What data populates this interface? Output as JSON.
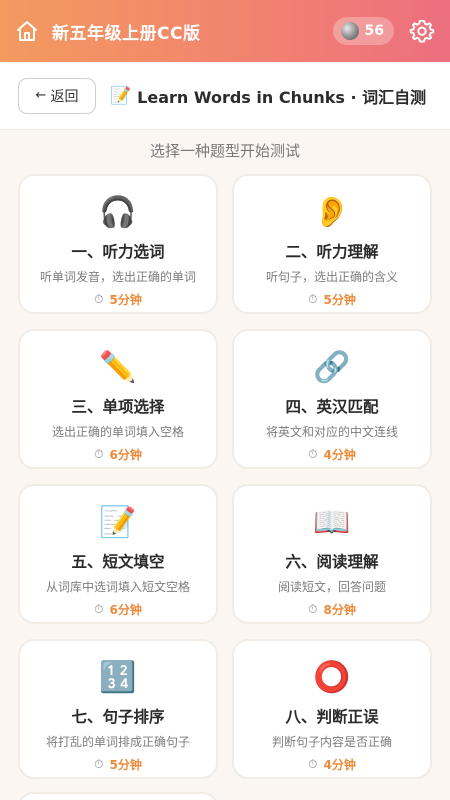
{
  "header": {
    "title": "新五年级上册CC版",
    "coins": "56",
    "coin_icon": "moon-icon",
    "home_icon": "home-icon",
    "settings_icon": "gear-icon",
    "gradient": [
      "#f39a5f",
      "#ec6f7f"
    ]
  },
  "toolbar": {
    "back_label": "返回",
    "back_arrow": "←",
    "memo_glyph": "📝",
    "title": "Learn Words in Chunks · 词汇自测"
  },
  "subtitle": "选择一种题型开始测试",
  "timer_glyph": "⏱",
  "accent_color": "#ee8a3a",
  "cards": [
    {
      "glyph": "🎧",
      "icon": "headphones-icon",
      "title": "一、听力选词",
      "desc": "听单词发音，选出正确的单词",
      "time": "5分钟"
    },
    {
      "glyph": "👂",
      "icon": "ear-icon",
      "title": "二、听力理解",
      "desc": "听句子，选出正确的含义",
      "time": "5分钟"
    },
    {
      "glyph": "✏️",
      "icon": "pencil-icon",
      "title": "三、单项选择",
      "desc": "选出正确的单词填入空格",
      "time": "6分钟"
    },
    {
      "glyph": "🔗",
      "icon": "link-icon",
      "title": "四、英汉匹配",
      "desc": "将英文和对应的中文连线",
      "time": "4分钟"
    },
    {
      "glyph": "📝",
      "icon": "memo-icon",
      "title": "五、短文填空",
      "desc": "从词库中选词填入短文空格",
      "time": "6分钟"
    },
    {
      "glyph": "📖",
      "icon": "book-icon",
      "title": "六、阅读理解",
      "desc": "阅读短文，回答问题",
      "time": "8分钟"
    },
    {
      "glyph": "🔢",
      "icon": "numbers-icon",
      "title": "七、句子排序",
      "desc": "将打乱的单词排成正确句子",
      "time": "5分钟"
    },
    {
      "glyph": "⭕",
      "icon": "circle-icon",
      "title": "八、判断正误",
      "desc": "判断句子内容是否正确",
      "time": "4分钟"
    }
  ]
}
